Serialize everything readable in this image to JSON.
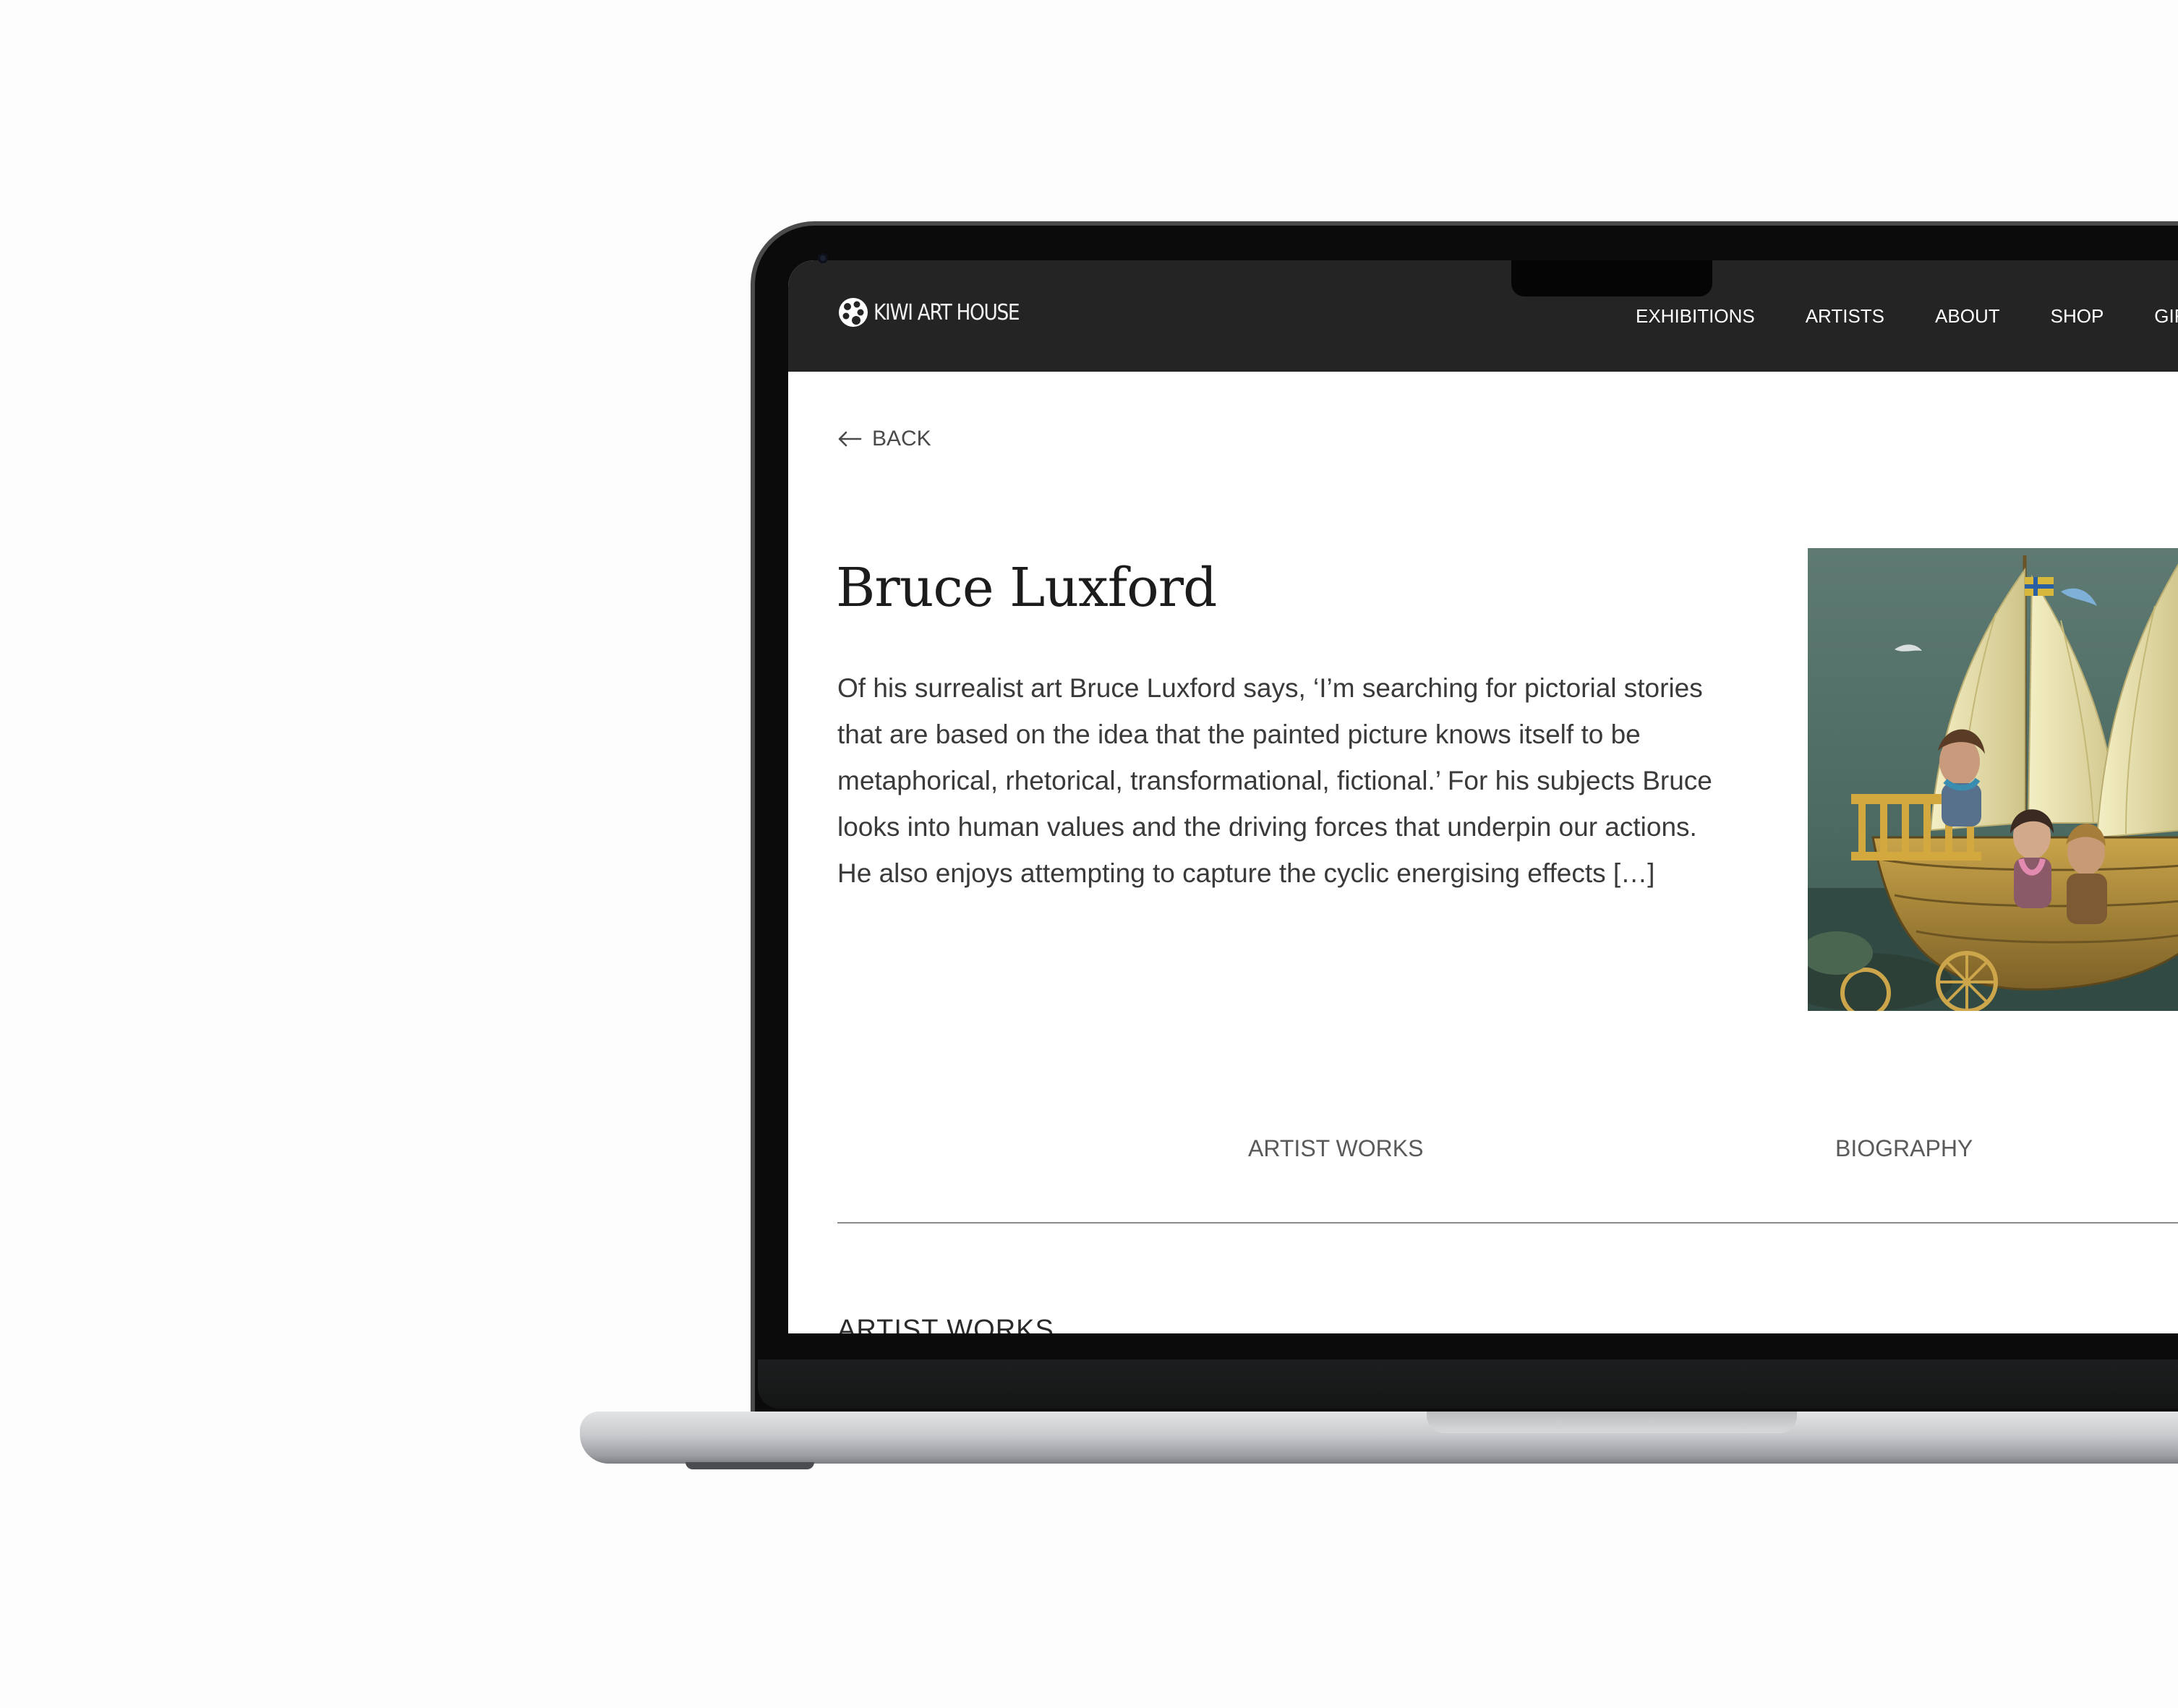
{
  "header": {
    "logo_text": "KIWI ART HOUSE",
    "nav": [
      {
        "label": "EXHIBITIONS"
      },
      {
        "label": "ARTISTS"
      },
      {
        "label": "ABOUT"
      },
      {
        "label": "SHOP"
      },
      {
        "label": "GIF"
      }
    ]
  },
  "page": {
    "back_label": "BACK",
    "artist_name": "Bruce Luxford",
    "bio": "Of his surrealist art Bruce Luxford says, ‘I’m searching for pictorial stories that are based on the idea that the painted picture knows itself to be metaphorical, rhetorical, transformational, fictional.’ For his subjects Bruce looks into human values and the driving forces that underpin our actions. He also enjoys attempting to capture  the cyclic energising effects […]",
    "tabs": [
      {
        "label": "ARTIST WORKS"
      },
      {
        "label": "BIOGRAPHY"
      }
    ],
    "section_heading": "ARTIST WORKS"
  },
  "colors": {
    "header_bg": "#242424",
    "page_bg": "#ffffff",
    "text_primary": "#1c1c1c",
    "text_secondary": "#5a5a5a"
  }
}
